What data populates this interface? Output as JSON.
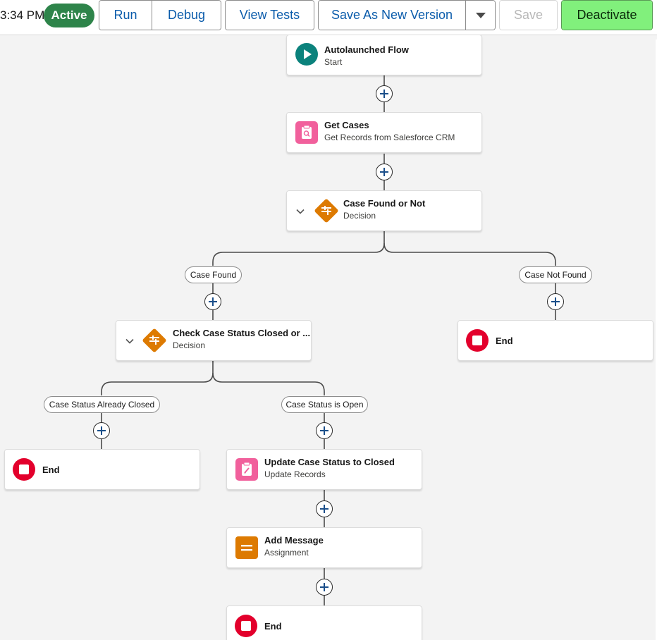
{
  "toolbar": {
    "time": "3:34 PM",
    "status": "Active",
    "run": "Run",
    "debug": "Debug",
    "view_tests": "View Tests",
    "save_as_new": "Save As New Version",
    "save": "Save",
    "deactivate": "Deactivate"
  },
  "colors": {
    "active_badge": "#2e844a",
    "deactivate_button": "#81f07c",
    "link_blue": "#0b5cab",
    "start_icon": "#0b827c",
    "decision_icon": "#dd7a01",
    "record_icon": "#f1609c",
    "assignment_icon": "#dd7a01",
    "end_icon": "#e3002c"
  },
  "nodes": {
    "start": {
      "title": "Autolaunched Flow",
      "subtitle": "Start",
      "icon": "play-icon"
    },
    "get_cases": {
      "title": "Get Cases",
      "subtitle": "Get Records from Salesforce CRM",
      "icon": "get-records-icon"
    },
    "decision1": {
      "title": "Case Found or Not",
      "subtitle": "Decision",
      "icon": "decision-icon"
    },
    "decision2": {
      "title": "Check Case Status Closed or ...",
      "subtitle": "Decision",
      "icon": "decision-icon"
    },
    "end_not_found": {
      "title": "End"
    },
    "end_closed": {
      "title": "End"
    },
    "update_case": {
      "title": "Update Case Status to Closed",
      "subtitle": "Update Records",
      "icon": "update-records-icon"
    },
    "add_message": {
      "title": "Add Message",
      "subtitle": "Assignment",
      "icon": "assignment-icon"
    },
    "end_final": {
      "title": "End"
    }
  },
  "branches": {
    "case_found": "Case Found",
    "case_not_found": "Case Not Found",
    "already_closed": "Case Status Already Closed",
    "is_open": "Case Status is Open"
  }
}
